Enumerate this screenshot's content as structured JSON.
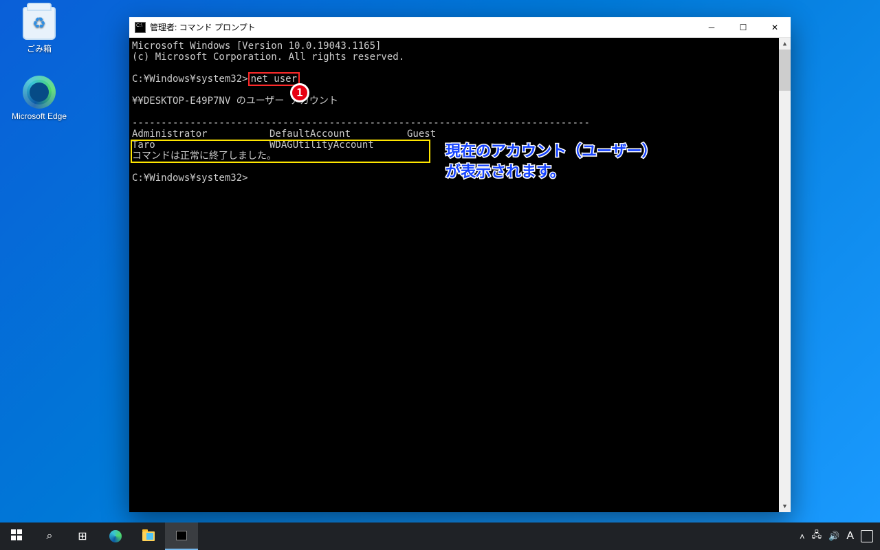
{
  "desktop_icons": {
    "recycle_bin": "ごみ箱",
    "edge": "Microsoft Edge"
  },
  "window": {
    "title": "管理者: コマンド プロンプト"
  },
  "terminal": {
    "line_version": "Microsoft Windows [Version 10.0.19043.1165]",
    "line_copyright": "(c) Microsoft Corporation. All rights reserved.",
    "prompt1_prefix": "C:¥Windows¥system32>",
    "command": "net user",
    "header": "¥¥DESKTOP-E49P7NV のユーザー アカウント",
    "separator": "-------------------------------------------------------------------------------",
    "row1_col1": "Administrator",
    "row1_col2": "DefaultAccount",
    "row1_col3": "Guest",
    "row2_col1": "Taro",
    "row2_col2": "WDAGUtilityAccount",
    "done": "コマンドは正常に終了しました。",
    "prompt2": "C:¥Windows¥system32>"
  },
  "annotations": {
    "badge1": "1",
    "note_line1": "現在のアカウント（ユーザー）",
    "note_line2": "が表示されます。"
  },
  "taskbar": {
    "ime": "A"
  }
}
